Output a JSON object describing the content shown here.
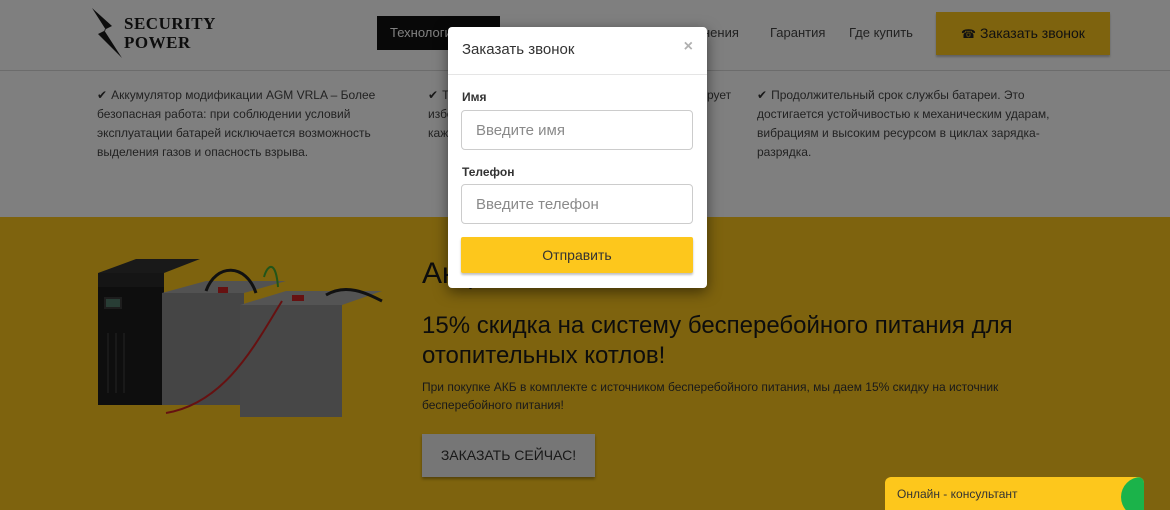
{
  "header": {
    "logo_line1": "SECURITY",
    "logo_line2": "POWER",
    "nav": [
      {
        "label": "Технологии"
      },
      {
        "label": "нения"
      },
      {
        "label": "Гарантия"
      },
      {
        "label": "Где купить"
      }
    ],
    "cta_label": "Заказать звонок"
  },
  "features": [
    {
      "text": "Аккумулятор модификации AGM VRLA – Более безопасная работа: при соблюдении условий эксплуатации батарей исключается возможность выделения газов и опасность взрыва."
    },
    {
      "text": "Т",
      "line2": "избе",
      "line3": "кажд",
      "tail": "рует"
    },
    {
      "text": "Продолжительный срок службы батареи. Это достигается устойчивостью к механическим ударам, вибрациям и высоким ресурсом в циклах зарядка-разрядка."
    }
  ],
  "promo": {
    "title": "Акция",
    "headline": "15% скидка на систему бесперебойного питания для отопительных котлов!",
    "text": "При покупке АКБ в комплекте с источником бесперебойного питания, мы даем 15% скидку на источник бесперебойного питания!",
    "button_label": "ЗАКАЗАТЬ СЕЙЧАС!"
  },
  "modal": {
    "title": "Заказать звонок",
    "close": "×",
    "name_label": "Имя",
    "name_placeholder": "Введите имя",
    "phone_label": "Телефон",
    "phone_placeholder": "Введите телефон",
    "submit_label": "Отправить"
  },
  "chat": {
    "label": "Онлайн - консультант"
  },
  "colors": {
    "accent": "#fdc71c",
    "dark": "#111111",
    "overlay": "rgba(0,0,0,0.5)"
  },
  "icons": [
    "lightning-bolt-icon",
    "phone-icon",
    "check-icon",
    "close-icon",
    "chat-icon"
  ]
}
